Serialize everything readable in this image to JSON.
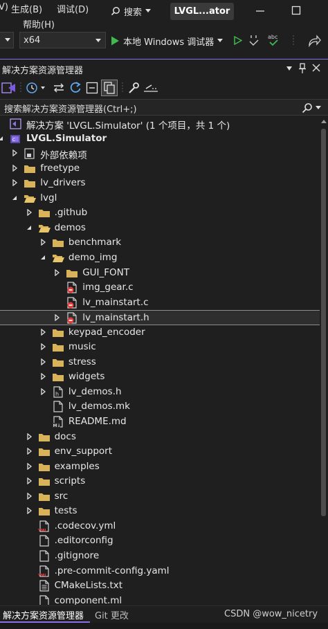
{
  "menubar": {
    "menu_partial": "V)",
    "build_menu": "生成(B)",
    "debug_menu": "调试(D)",
    "help_menu": "帮助(H)",
    "search_label": "搜索",
    "window_title": "LVGL...ator"
  },
  "toolbar": {
    "platform_value": "x64",
    "run_label": "本地 Windows 调试器"
  },
  "panel": {
    "title": "解决方案资源管理器",
    "search_placeholder": "搜索解决方案资源管理器(Ctrl+;)"
  },
  "tree": [
    {
      "label": "解决方案 'LVGL.Simulator' (1 个项目，共 1 个)",
      "depth": 0,
      "arrow": "none",
      "icon": "solution-icon"
    },
    {
      "label": "LVGL.Simulator",
      "depth": 0,
      "arrow": "expanded",
      "icon": "project-icon",
      "bold": true
    },
    {
      "label": "外部依赖项",
      "depth": 1,
      "arrow": "collapsed",
      "icon": "external-deps-icon"
    },
    {
      "label": "freetype",
      "depth": 1,
      "arrow": "collapsed",
      "icon": "folder-icon"
    },
    {
      "label": "lv_drivers",
      "depth": 1,
      "arrow": "collapsed",
      "icon": "folder-icon"
    },
    {
      "label": "lvgl",
      "depth": 1,
      "arrow": "expanded",
      "icon": "folder-open-icon"
    },
    {
      "label": ".github",
      "depth": 2,
      "arrow": "collapsed",
      "icon": "folder-icon"
    },
    {
      "label": "demos",
      "depth": 2,
      "arrow": "expanded",
      "icon": "folder-open-icon"
    },
    {
      "label": "benchmark",
      "depth": 3,
      "arrow": "collapsed",
      "icon": "folder-icon"
    },
    {
      "label": "demo_img",
      "depth": 3,
      "arrow": "expanded",
      "icon": "folder-open-icon"
    },
    {
      "label": "GUI_FONT",
      "depth": 4,
      "arrow": "collapsed",
      "icon": "folder-icon"
    },
    {
      "label": "img_gear.c",
      "depth": 4,
      "arrow": "none",
      "icon": "c-file-excluded-icon"
    },
    {
      "label": "lv_mainstart.c",
      "depth": 4,
      "arrow": "none",
      "icon": "c-file-excluded-icon"
    },
    {
      "label": "lv_mainstart.h",
      "depth": 4,
      "arrow": "collapsed",
      "icon": "h-file-excluded-icon",
      "selected": true
    },
    {
      "label": "keypad_encoder",
      "depth": 3,
      "arrow": "collapsed",
      "icon": "folder-icon"
    },
    {
      "label": "music",
      "depth": 3,
      "arrow": "collapsed",
      "icon": "folder-icon"
    },
    {
      "label": "stress",
      "depth": 3,
      "arrow": "collapsed",
      "icon": "folder-icon"
    },
    {
      "label": "widgets",
      "depth": 3,
      "arrow": "collapsed",
      "icon": "folder-icon"
    },
    {
      "label": "lv_demos.h",
      "depth": 3,
      "arrow": "collapsed",
      "icon": "h-file-icon"
    },
    {
      "label": "lv_demos.mk",
      "depth": 3,
      "arrow": "none",
      "icon": "file-icon"
    },
    {
      "label": "README.md",
      "depth": 3,
      "arrow": "none",
      "icon": "markdown-file-icon"
    },
    {
      "label": "docs",
      "depth": 2,
      "arrow": "collapsed",
      "icon": "folder-icon"
    },
    {
      "label": "env_support",
      "depth": 2,
      "arrow": "collapsed",
      "icon": "folder-icon"
    },
    {
      "label": "examples",
      "depth": 2,
      "arrow": "collapsed",
      "icon": "folder-icon"
    },
    {
      "label": "scripts",
      "depth": 2,
      "arrow": "collapsed",
      "icon": "folder-icon"
    },
    {
      "label": "src",
      "depth": 2,
      "arrow": "collapsed",
      "icon": "folder-icon"
    },
    {
      "label": "tests",
      "depth": 2,
      "arrow": "collapsed",
      "icon": "folder-icon"
    },
    {
      "label": ".codecov.yml",
      "depth": 2,
      "arrow": "none",
      "icon": "yml-file-icon"
    },
    {
      "label": ".editorconfig",
      "depth": 2,
      "arrow": "none",
      "icon": "file-icon"
    },
    {
      "label": ".gitignore",
      "depth": 2,
      "arrow": "none",
      "icon": "file-icon"
    },
    {
      "label": ".pre-commit-config.yaml",
      "depth": 2,
      "arrow": "none",
      "icon": "yml-file-icon"
    },
    {
      "label": "CMakeLists.txt",
      "depth": 2,
      "arrow": "none",
      "icon": "text-file-icon"
    },
    {
      "label": "component.ml",
      "depth": 2,
      "arrow": "none",
      "icon": "file-icon"
    }
  ],
  "bottom_tabs": {
    "solution_explorer": "解决方案资源管理器",
    "git_changes": "Git 更改"
  },
  "watermark": "CSDN @wow_nicetry",
  "colors": {
    "accent": "#8a6fe8",
    "folder": "#d8b35a",
    "excluded": "#e03c3c",
    "run_green": "#3fb950"
  }
}
